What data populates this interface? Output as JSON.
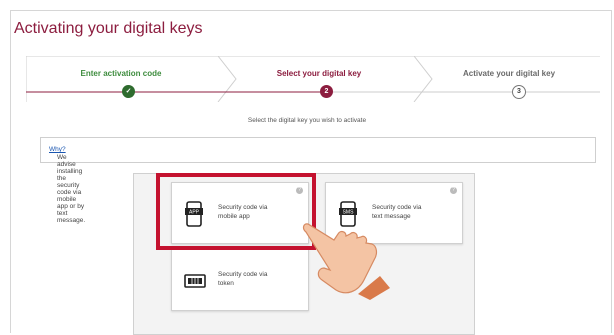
{
  "page": {
    "title": "Activating your digital keys"
  },
  "stepper": {
    "steps": [
      {
        "label": "Enter activation code",
        "indicator": "✓",
        "state": "done"
      },
      {
        "label": "Select your digital key",
        "indicator": "2",
        "state": "current"
      },
      {
        "label": "Activate your digital key",
        "indicator": "3",
        "state": "pending"
      }
    ]
  },
  "instruction": "Select the digital key you wish to activate",
  "advice": {
    "text": "We advise installing the security code via mobile app or by text message.",
    "link": "Why?"
  },
  "options": [
    {
      "icon_text": "APP",
      "label_line1": "Security code via",
      "label_line2": "mobile app",
      "icon": "smartphone-app-icon"
    },
    {
      "icon_text": "SMS",
      "label_line1": "Security code via",
      "label_line2": "text message",
      "icon": "smartphone-sms-icon"
    },
    {
      "icon_text": "",
      "label_line1": "Security code via",
      "label_line2": "token",
      "icon": "token-device-icon"
    }
  ],
  "colors": {
    "brand": "#8c1d3f",
    "done": "#2e6b2e",
    "highlight": "#c4122f",
    "link": "#1a56b0"
  }
}
